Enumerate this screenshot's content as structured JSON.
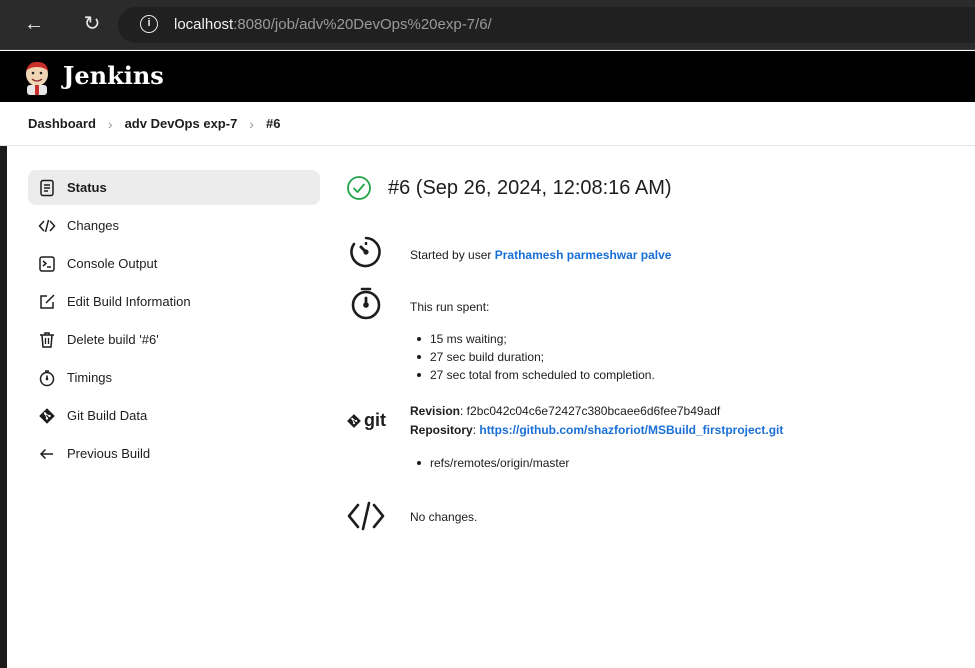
{
  "browser": {
    "url_host": "localhost",
    "url_rest": ":8080/job/adv%20DevOps%20exp-7/6/"
  },
  "header": {
    "brand": "Jenkins"
  },
  "breadcrumb": {
    "items": [
      "Dashboard",
      "adv DevOps exp-7",
      "#6"
    ]
  },
  "sidebar": {
    "items": [
      {
        "label": "Status",
        "icon": "document-icon",
        "active": true
      },
      {
        "label": "Changes",
        "icon": "code-icon"
      },
      {
        "label": "Console Output",
        "icon": "terminal-icon"
      },
      {
        "label": "Edit Build Information",
        "icon": "edit-icon"
      },
      {
        "label": "Delete build '#6'",
        "icon": "trash-icon"
      },
      {
        "label": "Timings",
        "icon": "timer-icon"
      },
      {
        "label": "Git Build Data",
        "icon": "git-diamond-icon"
      },
      {
        "label": "Previous Build",
        "icon": "arrow-left-icon"
      }
    ]
  },
  "build": {
    "title": "#6 (Sep 26, 2024, 12:08:16 AM)",
    "started_prefix": "Started by user ",
    "started_user": "Prathamesh parmeshwar palve",
    "run_spent": "This run spent:",
    "durations": [
      "15 ms waiting;",
      "27 sec build duration;",
      "27 sec total from scheduled to completion."
    ],
    "git_label": "git",
    "revision_label": "Revision",
    "revision": ": f2bc042c04c6e72427c380bcaee6d6fee7b49adf",
    "repository_label": "Repository",
    "repository_sep": ": ",
    "repository_url": "https://github.com/shazforiot/MSBuild_firstproject.git",
    "branches": [
      "refs/remotes/origin/master"
    ],
    "no_changes": "No changes."
  },
  "colors": {
    "success": "#1ea446",
    "link": "#1a6fd6",
    "header_bg": "#000000"
  }
}
